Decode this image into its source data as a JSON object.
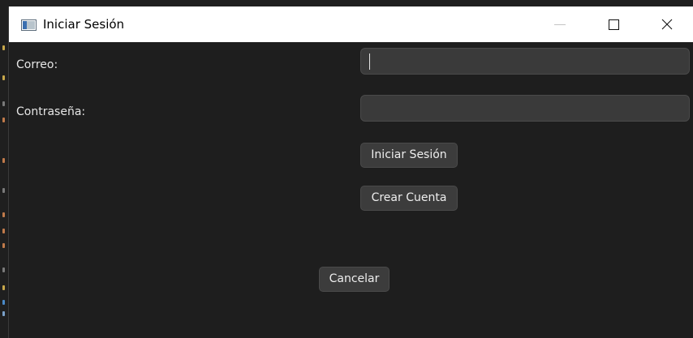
{
  "window": {
    "title": "Iniciar Sesión"
  },
  "form": {
    "email_label": "Correo:",
    "email_value": "",
    "password_label": "Contraseña:",
    "password_value": ""
  },
  "buttons": {
    "login_label": "Iniciar Sesión",
    "create_account_label": "Crear Cuenta",
    "cancel_label": "Cancelar"
  },
  "colors": {
    "background": "#1e1e1e",
    "titlebar": "#ffffff",
    "field_background": "#3a3a3a",
    "button_background": "#3c3c3c",
    "text": "#e6e6e6"
  },
  "icons": {
    "app": "app-window-icon",
    "minimize": "minimize-icon",
    "maximize": "maximize-icon",
    "close": "close-icon"
  }
}
